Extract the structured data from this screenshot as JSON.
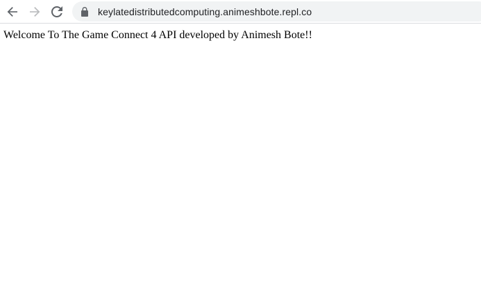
{
  "browser": {
    "url": "keylatedistributedcomputing.animeshbote.repl.co",
    "icons": {
      "back": "arrow-left-icon",
      "forward": "arrow-right-icon",
      "reload": "reload-icon",
      "lock": "lock-icon"
    },
    "colors": {
      "omnibox_bg": "#f1f3f4",
      "icon_active": "#5f6368",
      "icon_disabled": "#babcbe"
    }
  },
  "page": {
    "text": "Welcome To The Game Connect 4 API developed by Animesh Bote!!"
  }
}
